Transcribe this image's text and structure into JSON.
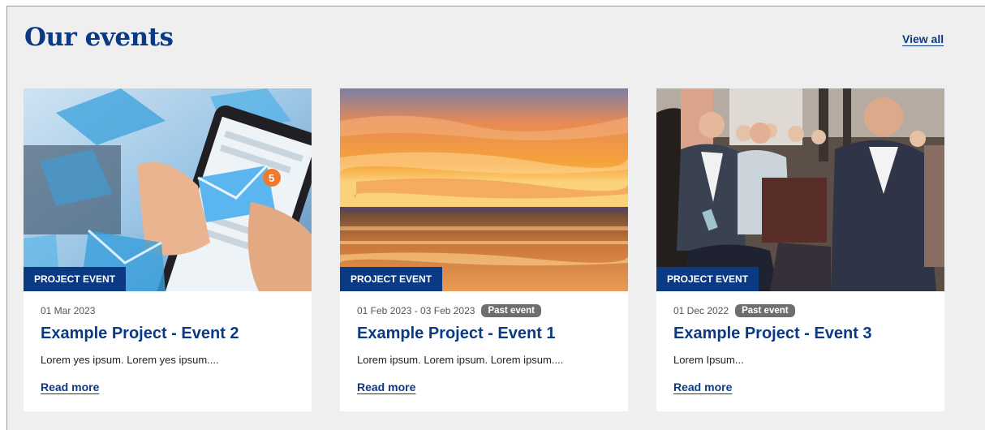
{
  "section": {
    "title": "Our events",
    "view_all_label": "View all"
  },
  "events": [
    {
      "image_subject": "hand holding phone with email envelope icons",
      "tag": "PROJECT EVENT",
      "date": "01 Mar 2023",
      "badge": "",
      "title": "Example Project - Event 2",
      "excerpt": "Lorem yes ipsum. Lorem yes ipsum....",
      "read_more": "Read more"
    },
    {
      "image_subject": "sunset over the sea",
      "tag": "PROJECT EVENT",
      "date": "01 Feb 2023 - 03 Feb 2023",
      "badge": "Past event",
      "title": "Example Project - Event 1",
      "excerpt": "Lorem ipsum. Lorem ipsum. Lorem ipsum....",
      "read_more": "Read more"
    },
    {
      "image_subject": "audience seated at a conference",
      "tag": "PROJECT EVENT",
      "date": "01 Dec 2022",
      "badge": "Past event",
      "title": "Example Project - Event 3",
      "excerpt": "Lorem Ipsum...",
      "read_more": "Read more"
    }
  ],
  "colors": {
    "brand": "#0b3a84",
    "badge": "#6e6e6e",
    "panel_bg": "#efefef"
  }
}
